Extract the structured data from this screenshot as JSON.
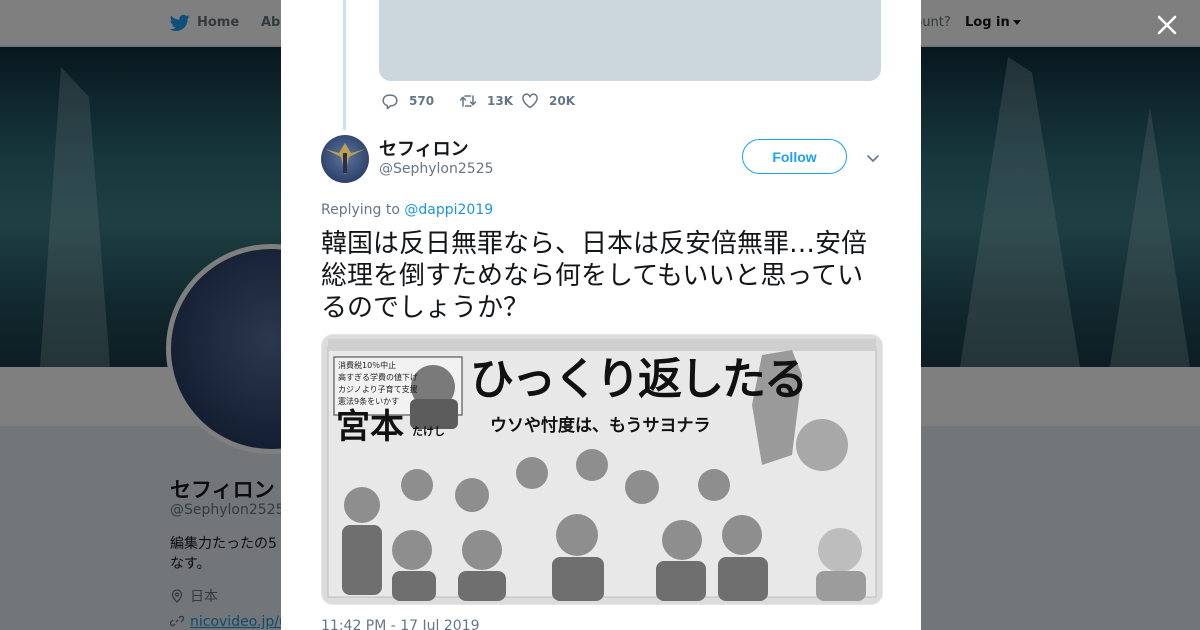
{
  "background": {
    "nav": {
      "home": "Home",
      "about": "Abo",
      "account_prompt": "ccount?",
      "login": "Log in"
    },
    "profile": {
      "name": "セフィロン",
      "handle": "@Sephylon2525",
      "bio": "編集力たったの5なす。",
      "location": "日本",
      "link": "nicovideo.jp/us"
    }
  },
  "modal": {
    "prev_tweet": {
      "replies": "570",
      "retweets": "13K",
      "likes": "20K"
    },
    "tweet": {
      "display_name": "セフィロン",
      "handle": "@Sephylon2525",
      "follow_label": "Follow",
      "replying_to_prefix": "Replying to",
      "replying_to_handle": "@dappi2019",
      "text": "韓国は反日無罪なら、日本は反安倍無罪…安倍総理を倒すためなら何をしてもいいと思っているのでしょうか？",
      "timestamp": "11:42 PM - 17 Jul 2019"
    },
    "photo": {
      "headline": "ひっくり返したる",
      "subhead": "ウソや忖度は、もうサヨナラ",
      "candidate": "宮本",
      "candidate_given": "たけし",
      "policies": [
        "消費税10％中止",
        "高すぎる学費の値下げ",
        "カジノより子育て支援",
        "憲法9条をいかす"
      ]
    }
  },
  "colors": {
    "accent": "#1da1f2",
    "link": "#1b95e0",
    "text": "#14171a",
    "muted": "#657786"
  }
}
